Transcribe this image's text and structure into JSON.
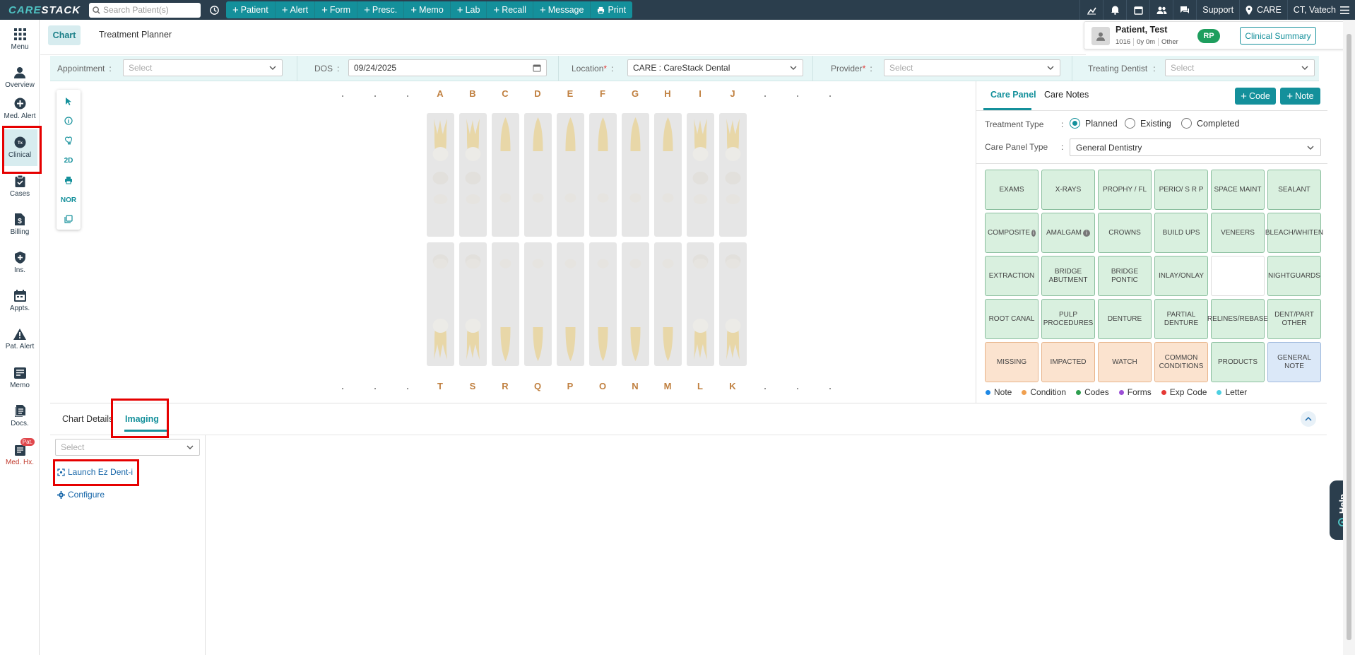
{
  "topbar": {
    "logo": "CARESTACK",
    "search_placeholder": "Search Patient(s)",
    "actions": [
      "Patient",
      "Alert",
      "Form",
      "Presc.",
      "Memo",
      "Lab",
      "Recall",
      "Message",
      "Print"
    ],
    "support": "Support",
    "location": "CARE",
    "user": "CT, Vatech"
  },
  "leftnav": {
    "items": [
      {
        "label": "Menu",
        "icon": "grid-icon"
      },
      {
        "label": "Overview",
        "icon": "person-icon"
      },
      {
        "label": "Med. Alert",
        "icon": "plus-circle-icon"
      },
      {
        "label": "Clinical",
        "icon": "tx-icon"
      },
      {
        "label": "Cases",
        "icon": "clipboard-icon"
      },
      {
        "label": "Billing",
        "icon": "dollar-doc-icon"
      },
      {
        "label": "Ins.",
        "icon": "shield-plus-icon"
      },
      {
        "label": "Appts.",
        "icon": "calendar-icon"
      },
      {
        "label": "Pat. Alert",
        "icon": "warning-icon"
      },
      {
        "label": "Memo",
        "icon": "memo-icon"
      },
      {
        "label": "Docs.",
        "icon": "docs-icon"
      },
      {
        "label": "Med. Hx.",
        "icon": "medhx-icon",
        "badge": "Pat."
      }
    ]
  },
  "tabs": {
    "chart": "Chart",
    "planner": "Treatment Planner"
  },
  "patient": {
    "name": "Patient, Test",
    "id": "1016",
    "age": "0y 0m",
    "gender": "Other",
    "initials": "RP",
    "summary_button": "Clinical Summary"
  },
  "filters": {
    "appointment_label": "Appointment",
    "appointment_placeholder": "Select",
    "dos_label": "DOS",
    "dos_value": "09/24/2025",
    "location_label": "Location",
    "location_value": "CARE : CareStack Dental",
    "provider_label": "Provider",
    "provider_placeholder": "Select",
    "dentist_label": "Treating Dentist",
    "dentist_placeholder": "Select",
    "colon": ":",
    "required_mark": "*"
  },
  "toolbox": {
    "items": [
      "cursor-icon",
      "info-icon",
      "tooth-icon",
      "2D",
      "print-icon",
      "NOR",
      "copy-icon"
    ]
  },
  "chart": {
    "top_letters": [
      ".",
      ".",
      ".",
      "A",
      "B",
      "C",
      "D",
      "E",
      "F",
      "G",
      "H",
      "I",
      "J",
      ".",
      ".",
      "."
    ],
    "bottom_letters": [
      ".",
      ".",
      ".",
      "T",
      "S",
      "R",
      "Q",
      "P",
      "O",
      "N",
      "M",
      "L",
      "K",
      ".",
      ".",
      "."
    ]
  },
  "care_panel": {
    "tab_panel": "Care Panel",
    "tab_notes": "Care Notes",
    "code_button": "Code",
    "note_button": "Note",
    "treatment_type_label": "Treatment Type",
    "treatment_types": [
      "Planned",
      "Existing",
      "Completed"
    ],
    "selected_treatment_type": "Planned",
    "panel_type_label": "Care Panel Type",
    "panel_type_value": "General Dentistry",
    "buttons": [
      {
        "label": "EXAMS",
        "color": "green"
      },
      {
        "label": "X-RAYS",
        "color": "green"
      },
      {
        "label": "PROPHY / FL",
        "color": "green"
      },
      {
        "label": "PERIO/ S R P",
        "color": "green"
      },
      {
        "label": "SPACE MAINT",
        "color": "green"
      },
      {
        "label": "SEALANT",
        "color": "green"
      },
      {
        "label": "COMPOSITE",
        "color": "green",
        "info": true
      },
      {
        "label": "AMALGAM",
        "color": "green",
        "info": true
      },
      {
        "label": "CROWNS",
        "color": "green"
      },
      {
        "label": "BUILD UPS",
        "color": "green"
      },
      {
        "label": "VENEERS",
        "color": "green"
      },
      {
        "label": "BLEACH/WHITEN",
        "color": "green"
      },
      {
        "label": "EXTRACTION",
        "color": "green"
      },
      {
        "label": "BRIDGE ABUTMENT",
        "color": "green"
      },
      {
        "label": "BRIDGE PONTIC",
        "color": "green"
      },
      {
        "label": "INLAY/ONLAY",
        "color": "green"
      },
      {
        "label": "",
        "color": "empty"
      },
      {
        "label": "NIGHTGUARDS",
        "color": "green"
      },
      {
        "label": "ROOT CANAL",
        "color": "green"
      },
      {
        "label": "PULP PROCEDURES",
        "color": "green"
      },
      {
        "label": "DENTURE",
        "color": "green"
      },
      {
        "label": "PARTIAL DENTURE",
        "color": "green"
      },
      {
        "label": "RELINES/REBASE",
        "color": "green"
      },
      {
        "label": "DENT/PART OTHER",
        "color": "green"
      },
      {
        "label": "MISSING",
        "color": "orange"
      },
      {
        "label": "IMPACTED",
        "color": "orange"
      },
      {
        "label": "WATCH",
        "color": "orange"
      },
      {
        "label": "COMMON CONDITIONS",
        "color": "orange"
      },
      {
        "label": "PRODUCTS",
        "color": "green"
      },
      {
        "label": "GENERAL NOTE",
        "color": "blue"
      }
    ],
    "legend": [
      {
        "label": "Note",
        "color": "#1e88e5"
      },
      {
        "label": "Condition",
        "color": "#f0a050"
      },
      {
        "label": "Codes",
        "color": "#2e9e4f"
      },
      {
        "label": "Forms",
        "color": "#9c4fd6"
      },
      {
        "label": "Exp Code",
        "color": "#e53935"
      },
      {
        "label": "Letter",
        "color": "#4dd0e1"
      }
    ]
  },
  "bottom": {
    "tab_details": "Chart Details",
    "tab_imaging": "Imaging",
    "select_placeholder": "Select",
    "launch_link": "Launch Ez Dent-i",
    "configure_link": "Configure"
  },
  "help": {
    "label": "Help"
  },
  "colors": {
    "accent": "#14909b",
    "topbar": "#2b3e4d",
    "highlight": "#e60000"
  }
}
